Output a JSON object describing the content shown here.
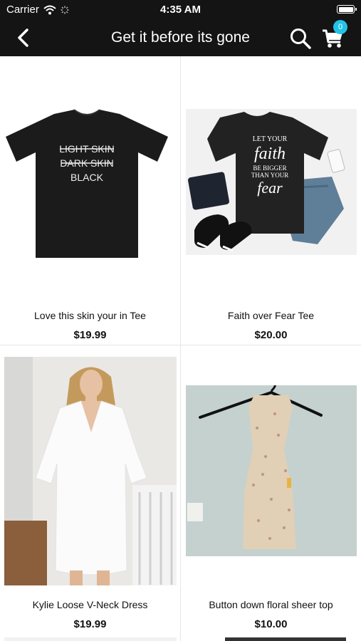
{
  "status_bar": {
    "carrier": "Carrier",
    "time": "4:35 AM"
  },
  "navbar": {
    "title": "Get it before its gone",
    "cart_count": "0"
  },
  "products": [
    {
      "name": "Love this skin your in Tee",
      "price": "$19.99",
      "shirt_lines": [
        "LIGHT SKIN",
        "DARK SKIN",
        "BLACK"
      ]
    },
    {
      "name": "Faith over Fear Tee",
      "price": "$20.00",
      "shirt_lines": [
        "LET YOUR",
        "faith",
        "BE BIGGER",
        "THAN YOUR",
        "fear"
      ]
    },
    {
      "name": "Kylie Loose V-Neck Dress",
      "price": "$19.99"
    },
    {
      "name": "Button down floral sheer top",
      "price": "$10.00"
    }
  ],
  "colors": {
    "bar": "#141414",
    "badge": "#22c3e6"
  }
}
